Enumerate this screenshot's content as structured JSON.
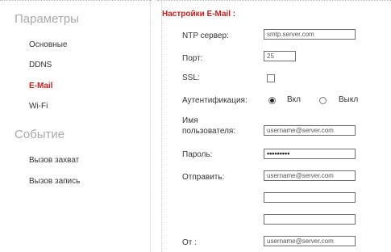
{
  "sidebar": {
    "params_header": "Параметры",
    "params_items": [
      "Основные",
      "DDNS",
      "E-Mail",
      "Wi-Fi"
    ],
    "events_header": "Событие",
    "events_items": [
      "Вызов захват",
      "Вызов запись"
    ],
    "active_item": "E-Mail"
  },
  "email": {
    "section_title": "Настройки E-Mail :",
    "ntp_label": "NTP сервер:",
    "ntp_value": "smtp.server.com",
    "port_label": "Порт:",
    "port_value": "25",
    "ssl_label": "SSL:",
    "ssl_checked": false,
    "auth_label": "Аутентификация:",
    "auth_on": "Вкл",
    "auth_off": "Выкл",
    "auth_selected": "Вкл",
    "username_label_1": "Имя",
    "username_label_2": "пользователя:",
    "username_value": "username@server.com",
    "password_label": "Пароль:",
    "password_value": "•••••••••",
    "send_label": "Отправить:",
    "send_values": [
      "username@server.com",
      "",
      ""
    ],
    "from_label": "От :",
    "from_value": "username@server.com"
  },
  "colors": {
    "accent": "#d11a1a",
    "header_gray": "#a9a9a9",
    "text": "#333333",
    "field_border": "#6e6e6e"
  }
}
